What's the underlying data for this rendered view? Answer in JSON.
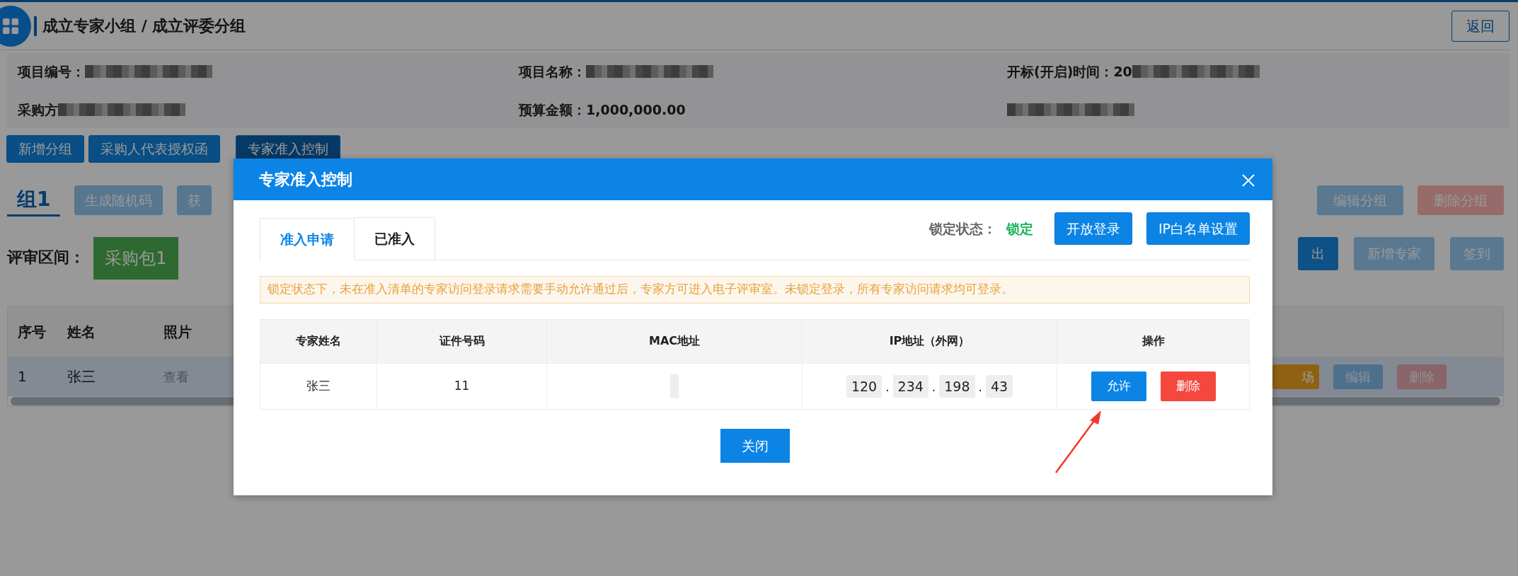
{
  "header": {
    "title": "成立专家小组 / 成立评委分组",
    "back_button": "返回"
  },
  "info": [
    {
      "label": "项目编号：",
      "masked": true
    },
    {
      "label": "项目名称：",
      "masked": true
    },
    {
      "label": "开标(开启)时间：",
      "value": "20",
      "masked": true
    },
    {
      "label": "采购方",
      "masked": true
    },
    {
      "label": "预算金额：",
      "value": "1,000,000.00"
    },
    {
      "masked": true
    }
  ],
  "toolbar": [
    {
      "label": "新增分组",
      "selected": false
    },
    {
      "label": "采购人代表授权函",
      "selected": false
    },
    {
      "label": "专家准入控制",
      "selected": true
    }
  ],
  "group": {
    "tab": "组1",
    "left_buttons": [
      {
        "label": "生成随机码",
        "disabled": true
      },
      {
        "label": "获",
        "disabled": true
      }
    ],
    "right_buttons": [
      {
        "label": "编辑分组",
        "kind": "primary",
        "disabled": true
      },
      {
        "label": "删除分组",
        "kind": "danger",
        "disabled": true
      }
    ]
  },
  "review": {
    "label": "评审区间：",
    "package": "采购包1",
    "buttons": [
      {
        "label": "出",
        "kind": "primary",
        "disabled": false
      },
      {
        "label": "新增专家",
        "kind": "primary",
        "disabled": true
      },
      {
        "label": "签到",
        "kind": "primary",
        "disabled": true
      }
    ]
  },
  "expert_table": {
    "columns": [
      "序号",
      "姓名",
      "照片"
    ],
    "rows": [
      {
        "cells": [
          "1",
          "张三",
          "查看"
        ],
        "actions": [
          {
            "label": "场",
            "kind": "warning",
            "disabled": false
          },
          {
            "label": "编辑",
            "kind": "primary",
            "disabled": true
          },
          {
            "label": "删除",
            "kind": "danger",
            "disabled": true
          }
        ]
      }
    ]
  },
  "modal": {
    "title": "专家准入控制",
    "tabs": [
      {
        "label": "准入申请",
        "selected": true
      },
      {
        "label": "已准入",
        "selected": false
      }
    ],
    "lock_label": "锁定状态：",
    "lock_value": "锁定",
    "locked": true,
    "buttons": [
      "开放登录",
      "IP白名单设置"
    ],
    "notice": "锁定状态下，未在准入清单的专家访问登录请求需要手动允许通过后，专家方可进入电子评审室。未锁定登录，所有专家访问请求均可登录。",
    "table": {
      "columns": [
        "专家姓名",
        "证件号码",
        "MAC地址",
        "IP地址（外网）",
        "操作"
      ],
      "rows": [
        {
          "name": "张三",
          "id_number": "11",
          "mac_blank": true,
          "ip": [
            "120",
            "234",
            "198",
            "43"
          ],
          "ip_separator": ".",
          "actions": [
            {
              "label": "允许",
              "kind": "primary"
            },
            {
              "label": "删除",
              "kind": "danger"
            }
          ]
        }
      ]
    },
    "close_button": "关闭"
  }
}
